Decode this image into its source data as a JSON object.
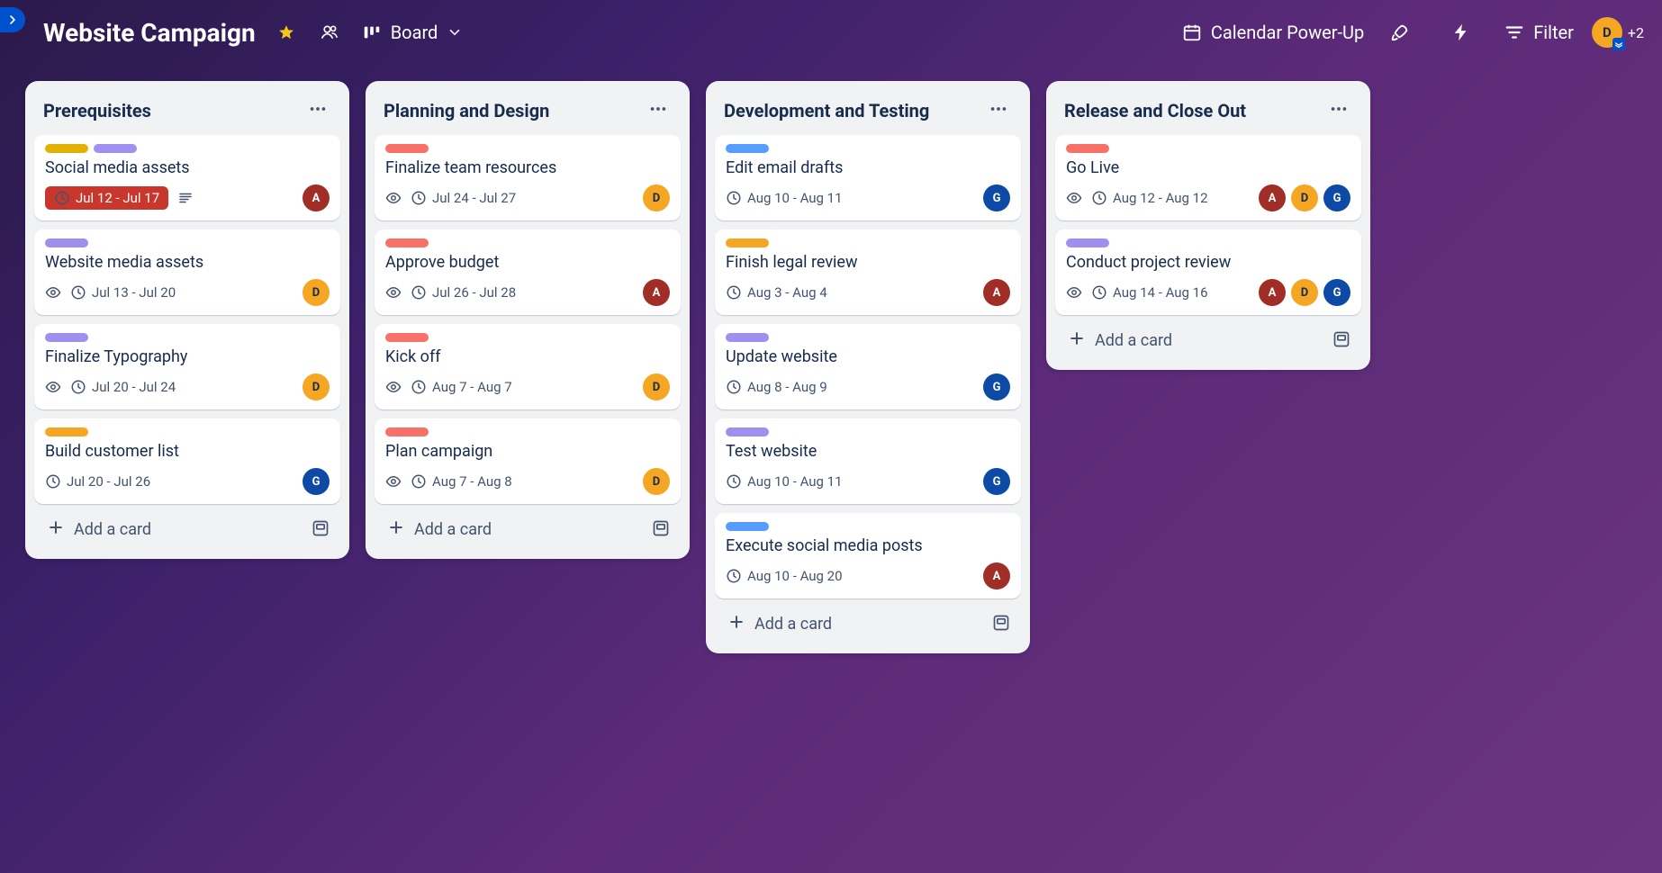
{
  "header": {
    "board_title": "Website Campaign",
    "view_label": "Board",
    "calendar_label": "Calendar Power-Up",
    "filter_label": "Filter",
    "extra_members_label": "+2",
    "current_user": {
      "initial": "D"
    }
  },
  "label_colors": {
    "yellow": "#e2b203",
    "purple": "#9f8fef",
    "orange": "#f5a623",
    "red": "#f87168",
    "blue": "#579dff"
  },
  "avatar_colors": {
    "A": "#a02d26",
    "D": "#f5a623",
    "G": "#0c4aa6"
  },
  "footer": {
    "add_card_label": "Add a card"
  },
  "lists": [
    {
      "title": "Prerequisites",
      "cards": [
        {
          "title": "Social media assets",
          "labels": [
            "yellow",
            "purple"
          ],
          "date": "Jul 12 - Jul 17",
          "overdue": true,
          "watch": false,
          "has_desc": true,
          "members": [
            "A"
          ]
        },
        {
          "title": "Website media assets",
          "labels": [
            "purple"
          ],
          "date": "Jul 13 - Jul 20",
          "overdue": false,
          "watch": true,
          "has_desc": false,
          "members": [
            "D"
          ]
        },
        {
          "title": "Finalize Typography",
          "labels": [
            "purple"
          ],
          "date": "Jul 20 - Jul 24",
          "overdue": false,
          "watch": true,
          "has_desc": false,
          "members": [
            "D"
          ]
        },
        {
          "title": "Build customer list",
          "labels": [
            "orange"
          ],
          "date": "Jul 20 - Jul 26",
          "overdue": false,
          "watch": false,
          "has_desc": false,
          "members": [
            "G"
          ]
        }
      ]
    },
    {
      "title": "Planning and Design",
      "cards": [
        {
          "title": "Finalize team resources",
          "labels": [
            "red"
          ],
          "date": "Jul 24 - Jul 27",
          "overdue": false,
          "watch": true,
          "has_desc": false,
          "members": [
            "D"
          ]
        },
        {
          "title": "Approve budget",
          "labels": [
            "red"
          ],
          "date": "Jul 26 - Jul 28",
          "overdue": false,
          "watch": true,
          "has_desc": false,
          "members": [
            "A"
          ]
        },
        {
          "title": "Kick off",
          "labels": [
            "red"
          ],
          "date": "Aug 7 - Aug 7",
          "overdue": false,
          "watch": true,
          "has_desc": false,
          "members": [
            "D"
          ]
        },
        {
          "title": "Plan campaign",
          "labels": [
            "red"
          ],
          "date": "Aug 7 - Aug 8",
          "overdue": false,
          "watch": true,
          "has_desc": false,
          "members": [
            "D"
          ]
        }
      ]
    },
    {
      "title": "Development and Testing",
      "cards": [
        {
          "title": "Edit email drafts",
          "labels": [
            "blue"
          ],
          "date": "Aug 10 - Aug 11",
          "overdue": false,
          "watch": false,
          "has_desc": false,
          "members": [
            "G"
          ]
        },
        {
          "title": "Finish legal review",
          "labels": [
            "orange"
          ],
          "date": "Aug 3 - Aug 4",
          "overdue": false,
          "watch": false,
          "has_desc": false,
          "members": [
            "A"
          ]
        },
        {
          "title": "Update website",
          "labels": [
            "purple"
          ],
          "date": "Aug 8 - Aug 9",
          "overdue": false,
          "watch": false,
          "has_desc": false,
          "members": [
            "G"
          ]
        },
        {
          "title": "Test website",
          "labels": [
            "purple"
          ],
          "date": "Aug 10 - Aug 11",
          "overdue": false,
          "watch": false,
          "has_desc": false,
          "members": [
            "G"
          ]
        },
        {
          "title": "Execute social media posts",
          "labels": [
            "blue"
          ],
          "date": "Aug 10 - Aug 20",
          "overdue": false,
          "watch": false,
          "has_desc": false,
          "members": [
            "A"
          ]
        }
      ]
    },
    {
      "title": "Release and Close Out",
      "cards": [
        {
          "title": "Go Live",
          "labels": [
            "red"
          ],
          "date": "Aug 12 - Aug 12",
          "overdue": false,
          "watch": true,
          "has_desc": false,
          "members": [
            "A",
            "D",
            "G"
          ]
        },
        {
          "title": "Conduct project review",
          "labels": [
            "purple"
          ],
          "date": "Aug 14 - Aug 16",
          "overdue": false,
          "watch": true,
          "has_desc": false,
          "members": [
            "A",
            "D",
            "G"
          ]
        }
      ]
    }
  ]
}
